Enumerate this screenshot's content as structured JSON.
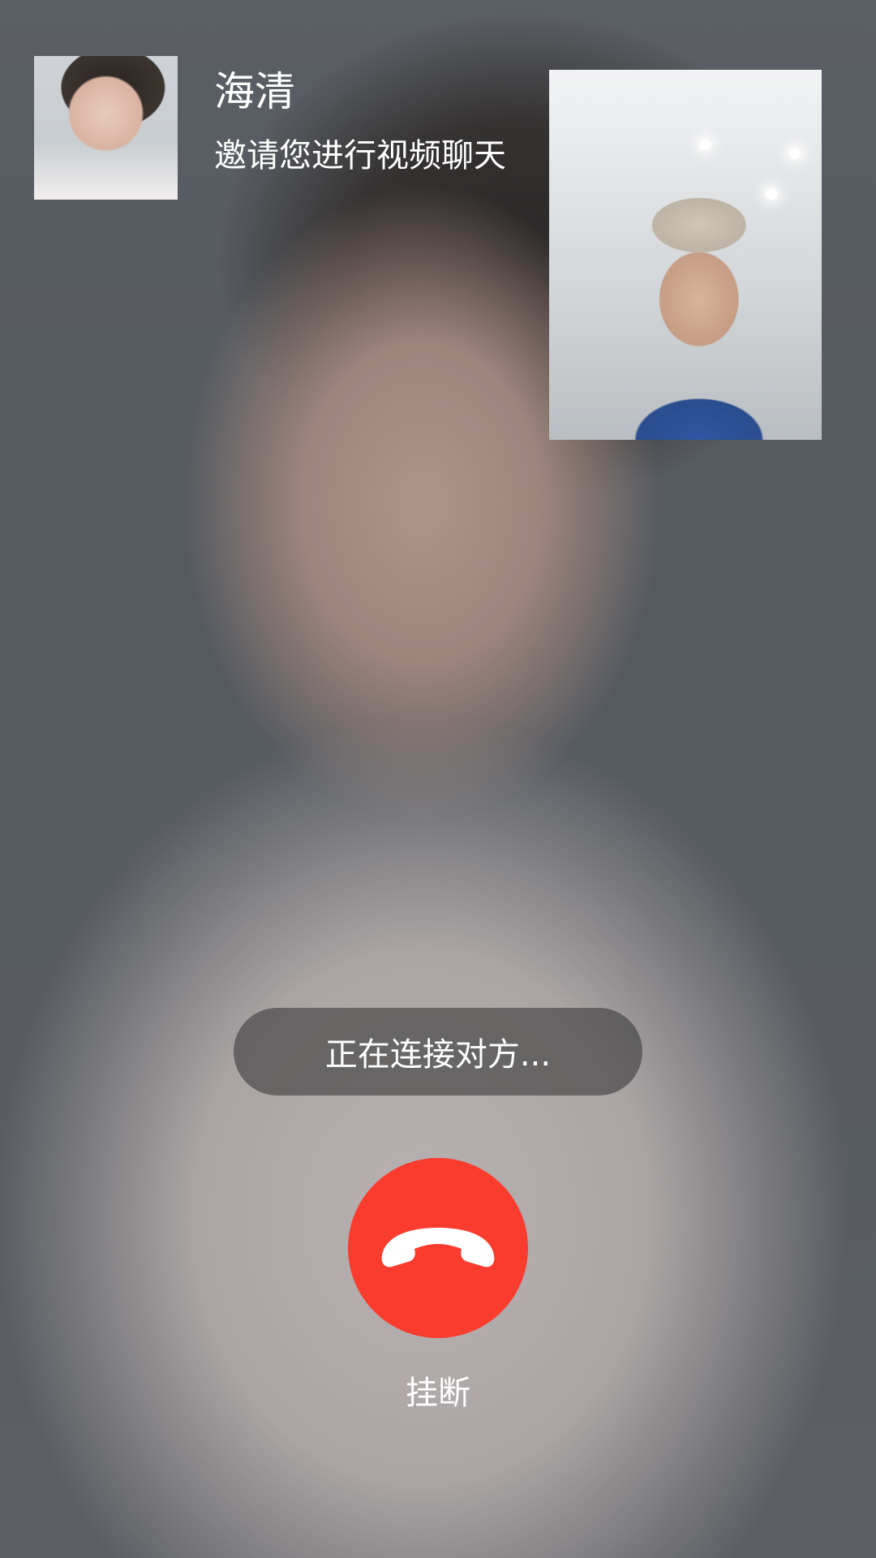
{
  "caller": {
    "name": "海清",
    "subtitle": "邀请您进行视频聊天",
    "avatar_icon": "avatar"
  },
  "status": {
    "text": "正在连接对方..."
  },
  "actions": {
    "hangup_label": "挂断",
    "hangup_icon": "phone-hangup-icon",
    "hangup_color": "#fa3c2f"
  }
}
